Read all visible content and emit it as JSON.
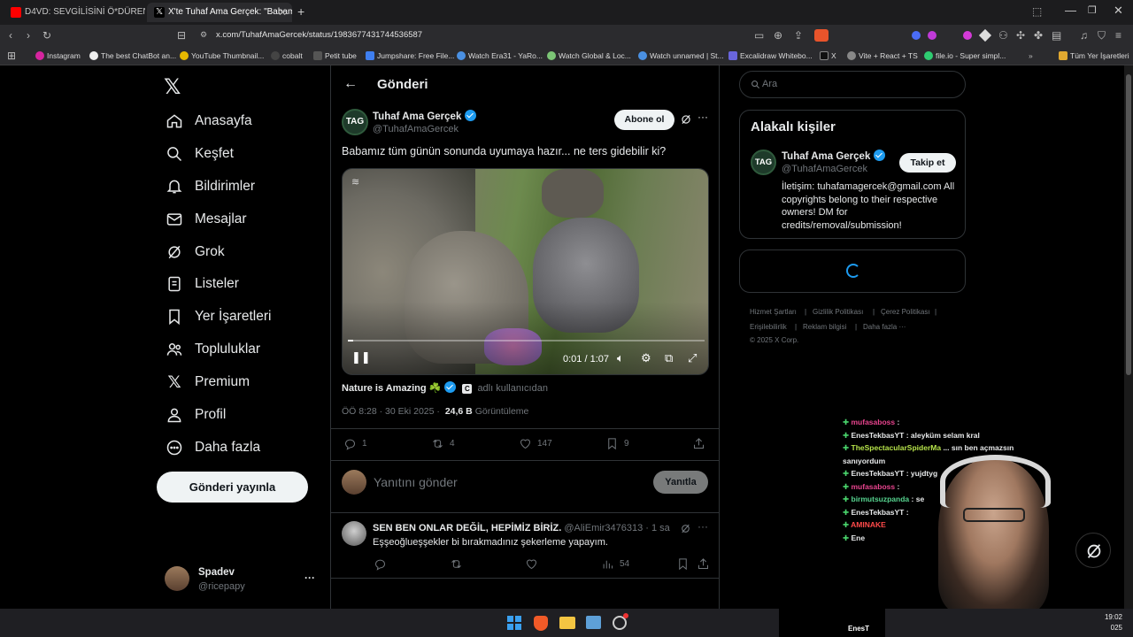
{
  "browser": {
    "tabs": [
      {
        "title": "D4VD: SEVGİLİSİNİ Ö*DÜREN ŞARKIC"
      },
      {
        "title": "X'te Tuhaf Ama Gerçek: \"Babamı"
      }
    ],
    "url": "x.com/TuhafAmaGercek/status/1983677431744536587",
    "bookmarks": [
      "Instagram",
      "The best ChatBot an...",
      "YouTube Thumbnail...",
      "cobalt",
      "Petit tube",
      "Jumpshare: Free File...",
      "Watch Era31 - YaRo...",
      "Watch Global & Loc...",
      "Watch unnamed | St...",
      "Excalidraw Whitebo...",
      "X",
      "Vite + React + TS",
      "file.io - Super simpl...",
      "Tüm Yer İşaretleri"
    ]
  },
  "sidebar": {
    "items": [
      {
        "label": "Anasayfa",
        "icon": "home-icon"
      },
      {
        "label": "Keşfet",
        "icon": "search-icon"
      },
      {
        "label": "Bildirimler",
        "icon": "bell-icon"
      },
      {
        "label": "Mesajlar",
        "icon": "mail-icon"
      },
      {
        "label": "Grok",
        "icon": "grok-icon"
      },
      {
        "label": "Listeler",
        "icon": "list-icon"
      },
      {
        "label": "Yer İşaretleri",
        "icon": "bookmark-icon"
      },
      {
        "label": "Topluluklar",
        "icon": "communities-icon"
      },
      {
        "label": "Premium",
        "icon": "x-logo-icon"
      },
      {
        "label": "Profil",
        "icon": "profile-icon"
      },
      {
        "label": "Daha fazla",
        "icon": "more-circle-icon"
      }
    ],
    "post_button": "Gönderi yayınla",
    "account": {
      "name": "Spadev",
      "handle": "@ricepapy",
      "more": "···"
    }
  },
  "main": {
    "header_title": "Gönderi",
    "tweet": {
      "avatar_text": "TAG",
      "author_name": "Tuhaf Ama Gerçek",
      "author_handle": "@TuhafAmaGercek",
      "subscribe_label": "Abone ol",
      "text": "Babamız tüm günün sonunda uyumaya hazır... ne ters gidebilir ki?",
      "video": {
        "time": "0:01 / 1:07",
        "progress": 0.015
      },
      "source_name": "Nature is Amazing ☘️",
      "source_suffix": "adlı kullanıcıdan",
      "timestamp": "ÖÖ 8:28 · 30 Eki 2025 ·",
      "views_count": "24,6 B",
      "views_label": "Görüntüleme",
      "stats": {
        "replies": "1",
        "reposts": "4",
        "likes": "147",
        "bookmarks": "9"
      }
    },
    "reply_box": {
      "placeholder": "Yanıtını gönder",
      "button": "Yanıtla"
    },
    "reply": {
      "name": "SEN BEN ONLAR DEĞİL, HEPİMİZ BİRİZ.",
      "handle": "@AliEmir3476313 · 1 sa",
      "text": "Eşşeoğlueşşekler bi bırakmadınız şekerleme yapayım.",
      "views": "54"
    }
  },
  "right": {
    "search_placeholder": "Ara",
    "related_title": "Alakalı kişiler",
    "person": {
      "name": "Tuhaf Ama Gerçek",
      "handle": "@TuhafAmaGercek",
      "follow": "Takip et",
      "bio": "İletişim: tuhafamagercek@gmail.com All copyrights belong to their respective owners! DM for credits/removal/submission!"
    },
    "footer": [
      "Hizmet Şartları",
      "Gizlilik Politikası",
      "Çerez Politikası",
      "Erişilebilirlik",
      "Reklam bilgisi",
      "Daha fazla ···",
      "© 2025 X Corp."
    ]
  },
  "stream_chat": [
    {
      "user": "mufasaboss",
      "msg": ":",
      "color": "#e8448e"
    },
    {
      "user": "EnesTekbasYT",
      "msg": ": aleyküm selam kral",
      "color": "#ffffff"
    },
    {
      "user": "TheSpectacularSpiderMa",
      "msg": "... sın ben açmazsın",
      "color": "#b6e34a"
    },
    {
      "user": "",
      "msg": "sanıyordum",
      "color": "#ffffff"
    },
    {
      "user": "EnesTekbasYT",
      "msg": ": yujdtyg",
      "color": "#ffffff"
    },
    {
      "user": "mufasaboss",
      "msg": ":",
      "color": "#e8448e"
    },
    {
      "user": "birmutsuzpanda",
      "msg": ": se",
      "color": "#56d38f"
    },
    {
      "user": "EnesTekbasYT",
      "msg": ":",
      "color": "#ffffff"
    },
    {
      "user": "AMINAKE",
      "msg": "",
      "color": "#ff4a4a"
    },
    {
      "user": "Ene",
      "msg": "",
      "color": "#ffffff"
    }
  ],
  "taskbar": {
    "clock": "19:02",
    "date": "025",
    "overlay_name": "EnesT"
  }
}
